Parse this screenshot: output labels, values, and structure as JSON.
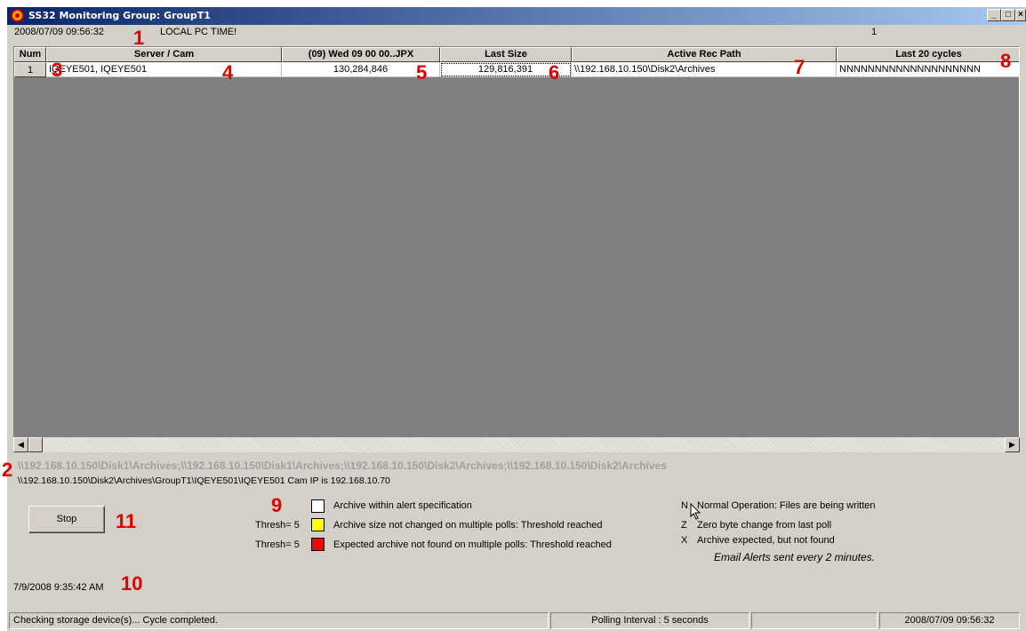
{
  "window": {
    "title": "SS32 Monitoring Group: GroupT1",
    "min": "_",
    "max": "□",
    "close": "×"
  },
  "top": {
    "pc_time": "2008/07/09 09:56:32",
    "local_label": "LOCAL PC TIME!",
    "count": "1"
  },
  "grid": {
    "headers": [
      "Num",
      "Server / Cam",
      "(09) Wed 09 00 00..JPX",
      "Last Size",
      "Active Rec Path",
      "Last 20 cycles"
    ],
    "rows": [
      [
        "1",
        "IQEYE501, IQEYE501",
        "130,284,846",
        "129,816,391",
        "\\\\192.168.10.150\\Disk2\\Archives",
        "NNNNNNNNNNNNNNNNNNNN"
      ]
    ]
  },
  "scroll": {
    "left_arrow": "◀",
    "right_arrow": "▶"
  },
  "paths": {
    "archive_list": "\\\\192.168.10.150\\Disk1\\Archives;\\\\192.168.10.150\\Disk1\\Archives;\\\\192.168.10.150\\Disk2\\Archives;\\\\192.168.10.150\\Disk2\\Archives",
    "cam_path": "\\\\192.168.10.150\\Disk2\\Archives\\GroupT1\\IQEYE501\\IQEYE501 Cam IP is 192.168.10.70"
  },
  "controls": {
    "stop_label": "Stop"
  },
  "legend": {
    "white_text": "Archive within alert specification",
    "yellow_thresh": "Thresh= 5",
    "yellow_text": "Archive size not changed on multiple polls: Threshold reached",
    "red_thresh": "Thresh= 5",
    "red_text": "Expected archive not found on multiple polls: Threshold reached",
    "colors": {
      "white": "#ffffff",
      "yellow": "#ffff00",
      "red": "#ff0000"
    }
  },
  "codes": {
    "n_key": "N",
    "n_text": "Normal Operation: Files are being written",
    "z_key": "Z",
    "z_text": "Zero byte change from last poll",
    "x_key": "X",
    "x_text": "Archive expected, but not found",
    "email": "Email Alerts sent every 2 minutes."
  },
  "bottom_datetime": "7/9/2008 9:35:42 AM",
  "statusbar": {
    "message": "Checking storage device(s)... Cycle completed.",
    "polling": "Polling Interval : 5 seconds",
    "blank": "",
    "time": "2008/07/09 09:56:32"
  },
  "annotations": [
    "1",
    "2",
    "3",
    "4",
    "5",
    "6",
    "7",
    "8",
    "9",
    "10",
    "11"
  ]
}
